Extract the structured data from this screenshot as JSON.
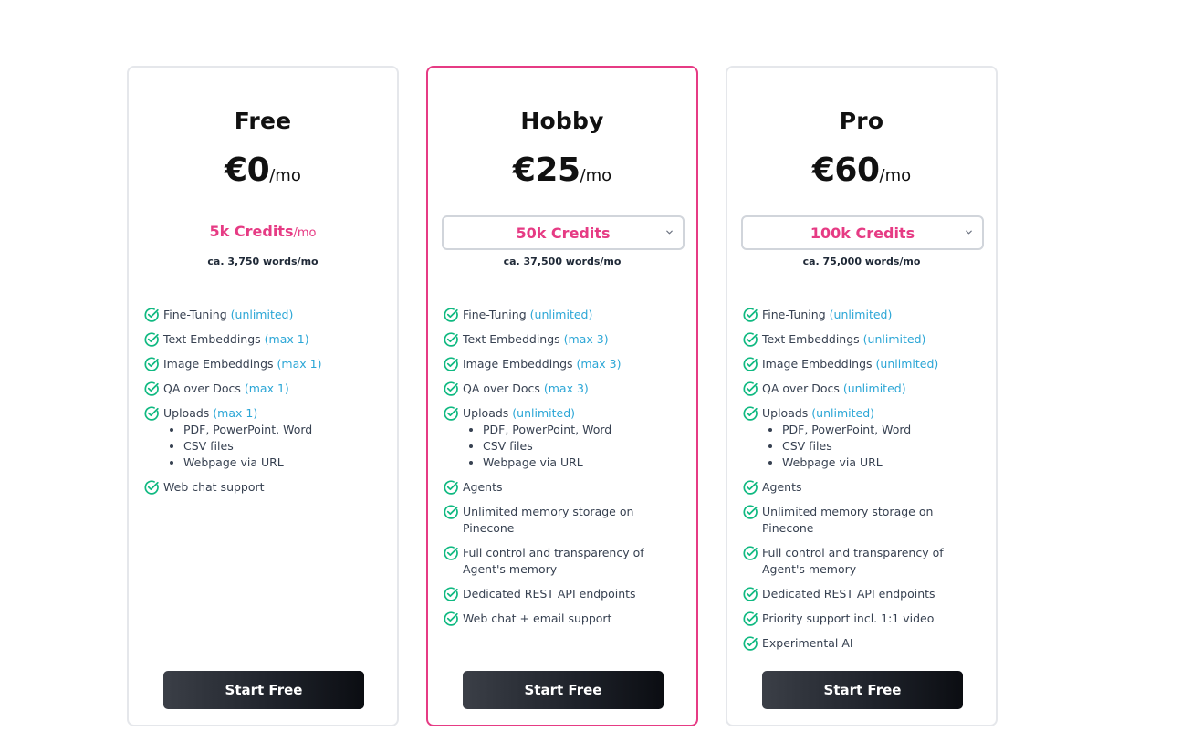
{
  "colors": {
    "accent": "#e63b84",
    "check": "#10b981",
    "qualifier": "#2ba6d6"
  },
  "plans": [
    {
      "name": "Free",
      "price": "€0",
      "per": "/mo",
      "credits": "5k Credits",
      "credits_per": "/mo",
      "words": "ca. 3,750 words/mo",
      "features": [
        {
          "text": "Fine-Tuning",
          "qualifier": "(unlimited)"
        },
        {
          "text": "Text Embeddings",
          "qualifier": "(max 1)"
        },
        {
          "text": "Image Embeddings",
          "qualifier": "(max 1)"
        },
        {
          "text": "QA over Docs",
          "qualifier": "(max 1)"
        },
        {
          "text": "Uploads",
          "qualifier": "(max 1)"
        },
        {
          "text": "Web chat support",
          "qualifier": ""
        }
      ],
      "upload_types": [
        "PDF, PowerPoint, Word",
        "CSV files",
        "Webpage via URL"
      ],
      "cta": "Start Free"
    },
    {
      "name": "Hobby",
      "price": "€25",
      "per": "/mo",
      "credits": "50k Credits",
      "words": "ca. 37,500 words/mo",
      "features": [
        {
          "text": "Fine-Tuning",
          "qualifier": "(unlimited)"
        },
        {
          "text": "Text Embeddings",
          "qualifier": "(max 3)"
        },
        {
          "text": "Image Embeddings",
          "qualifier": "(max 3)"
        },
        {
          "text": "QA over Docs",
          "qualifier": "(max 3)"
        },
        {
          "text": "Uploads",
          "qualifier": "(unlimited)"
        },
        {
          "text": "Agents",
          "qualifier": ""
        },
        {
          "text": "Unlimited memory storage on Pinecone",
          "qualifier": ""
        },
        {
          "text": "Full control and transparency of Agent's memory",
          "qualifier": ""
        },
        {
          "text": "Dedicated REST API endpoints",
          "qualifier": ""
        },
        {
          "text": "Web chat + email support",
          "qualifier": ""
        }
      ],
      "upload_types": [
        "PDF, PowerPoint, Word",
        "CSV files",
        "Webpage via URL"
      ],
      "cta": "Start Free"
    },
    {
      "name": "Pro",
      "price": "€60",
      "per": "/mo",
      "credits": "100k Credits",
      "words": "ca. 75,000 words/mo",
      "features": [
        {
          "text": "Fine-Tuning",
          "qualifier": "(unlimited)"
        },
        {
          "text": "Text Embeddings",
          "qualifier": "(unlimited)"
        },
        {
          "text": "Image Embeddings",
          "qualifier": "(unlimited)"
        },
        {
          "text": "QA over Docs",
          "qualifier": "(unlimited)"
        },
        {
          "text": "Uploads",
          "qualifier": "(unlimited)"
        },
        {
          "text": "Agents",
          "qualifier": ""
        },
        {
          "text": "Unlimited memory storage on Pinecone",
          "qualifier": ""
        },
        {
          "text": "Full control and transparency of Agent's memory",
          "qualifier": ""
        },
        {
          "text": "Dedicated REST API endpoints",
          "qualifier": ""
        },
        {
          "text": "Priority support incl. 1:1 video",
          "qualifier": ""
        },
        {
          "text": "Experimental AI",
          "qualifier": ""
        }
      ],
      "upload_types": [
        "PDF, PowerPoint, Word",
        "CSV files",
        "Webpage via URL"
      ],
      "cta": "Start Free"
    }
  ]
}
